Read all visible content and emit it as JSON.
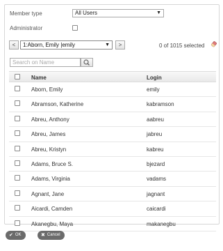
{
  "form": {
    "member_type_label": "Member type",
    "member_type_value": "All Users",
    "administrator_label": "Administrator"
  },
  "navigator": {
    "prev_label": "<",
    "next_label": ">",
    "current_user": "1:Aborn, Emily |emily",
    "selected_count": "0 of 1015 selected"
  },
  "search": {
    "placeholder": "Search on Name"
  },
  "table": {
    "headers": {
      "name": "Name",
      "login": "Login"
    },
    "rows": [
      {
        "name": "Aborn, Emily",
        "login": "emily"
      },
      {
        "name": "Abramson, Katherine",
        "login": "kabramson"
      },
      {
        "name": "Abreu, Anthony",
        "login": "aabreu"
      },
      {
        "name": "Abreu, James",
        "login": "jabreu"
      },
      {
        "name": "Abreu, Kristyn",
        "login": "kabreu"
      },
      {
        "name": "Adams, Bruce S.",
        "login": "bjezard"
      },
      {
        "name": "Adams, Virginia",
        "login": "vadams"
      },
      {
        "name": "Agnant, Jane",
        "login": "jagnant"
      },
      {
        "name": "Aicardi, Camden",
        "login": "caicardi"
      },
      {
        "name": "Akanegbu, Maya",
        "login": "makanegbu"
      }
    ]
  },
  "footer": {
    "ok_label": "OK",
    "cancel_label": "Cancel"
  },
  "icons": {
    "dropdown": "chevron-down-icon",
    "search": "magnifier-icon",
    "clear": "eraser-icon",
    "ok": "check-icon",
    "cancel": "x-icon"
  }
}
